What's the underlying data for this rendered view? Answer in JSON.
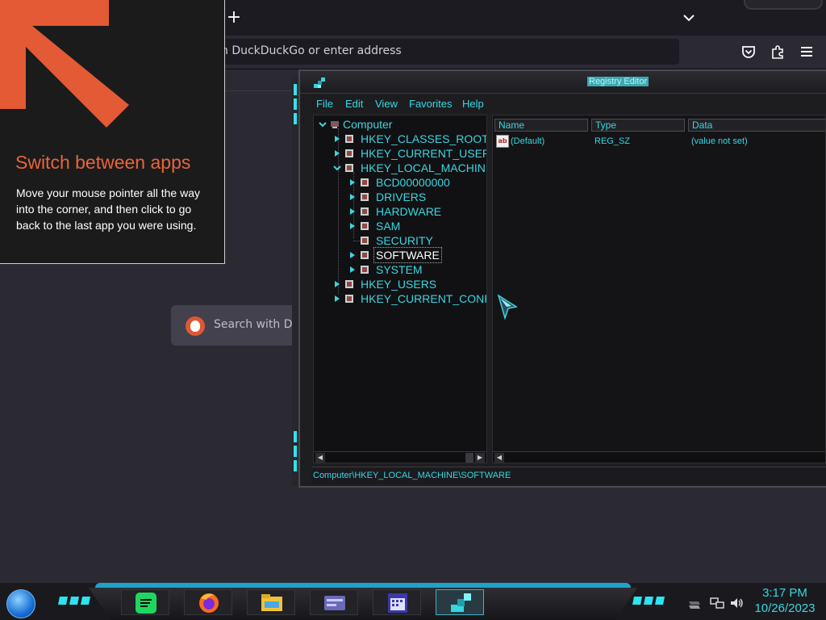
{
  "browser": {
    "url_placeholder": "h DuckDuckGo or enter address",
    "newtab_search_placeholder": "Search with Duc",
    "new_tab_symbol": "+"
  },
  "tip": {
    "title": "Switch between apps",
    "body": "Move your mouse pointer all the way into the corner, and then click to go back to the last app you were using.",
    "accent_color": "#e8643c"
  },
  "regedit": {
    "title": "Registry Editor",
    "menu": [
      "File",
      "Edit",
      "View",
      "Favorites",
      "Help"
    ],
    "tree": {
      "root": "Computer",
      "hives": [
        "HKEY_CLASSES_ROOT",
        "HKEY_CURRENT_USER",
        "HKEY_LOCAL_MACHINE"
      ],
      "hklm_children": [
        "BCD00000000",
        "DRIVERS",
        "HARDWARE",
        "SAM",
        "SECURITY",
        "SOFTWARE",
        "SYSTEM"
      ],
      "hives_after": [
        "HKEY_USERS",
        "HKEY_CURRENT_CONFI"
      ],
      "selected": "SOFTWARE"
    },
    "columns": [
      "Name",
      "Type",
      "Data"
    ],
    "values": [
      {
        "name": "(Default)",
        "type": "REG_SZ",
        "data": "(value not set)"
      }
    ],
    "status_path": "Computer\\HKEY_LOCAL_MACHINE\\SOFTWARE",
    "accent_color": "#37d7e3"
  },
  "taskbar": {
    "apps": [
      "spotify-icon",
      "firefox-icon",
      "file-explorer-icon",
      "control-panel-icon",
      "calendar-icon",
      "registry-editor-icon"
    ],
    "active_app": "registry-editor-icon",
    "time": "3:17 PM",
    "date": "10/26/2023"
  }
}
